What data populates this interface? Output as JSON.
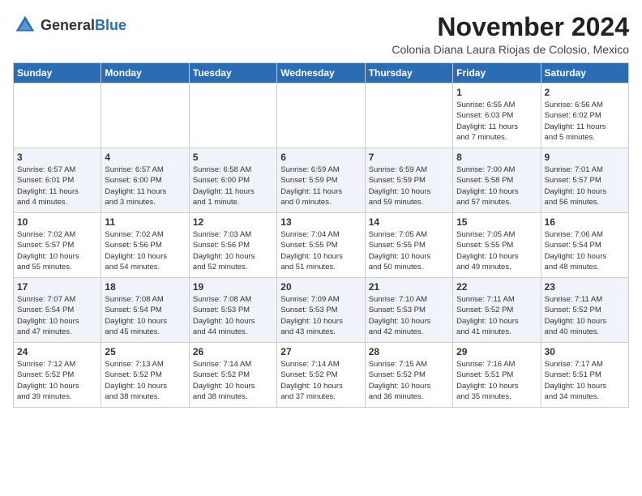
{
  "logo": {
    "general": "General",
    "blue": "Blue"
  },
  "title": "November 2024",
  "subtitle": "Colonia Diana Laura Riojas de Colosio, Mexico",
  "weekdays": [
    "Sunday",
    "Monday",
    "Tuesday",
    "Wednesday",
    "Thursday",
    "Friday",
    "Saturday"
  ],
  "weeks": [
    [
      {
        "day": "",
        "info": ""
      },
      {
        "day": "",
        "info": ""
      },
      {
        "day": "",
        "info": ""
      },
      {
        "day": "",
        "info": ""
      },
      {
        "day": "",
        "info": ""
      },
      {
        "day": "1",
        "info": "Sunrise: 6:55 AM\nSunset: 6:03 PM\nDaylight: 11 hours\nand 7 minutes."
      },
      {
        "day": "2",
        "info": "Sunrise: 6:56 AM\nSunset: 6:02 PM\nDaylight: 11 hours\nand 5 minutes."
      }
    ],
    [
      {
        "day": "3",
        "info": "Sunrise: 6:57 AM\nSunset: 6:01 PM\nDaylight: 11 hours\nand 4 minutes."
      },
      {
        "day": "4",
        "info": "Sunrise: 6:57 AM\nSunset: 6:00 PM\nDaylight: 11 hours\nand 3 minutes."
      },
      {
        "day": "5",
        "info": "Sunrise: 6:58 AM\nSunset: 6:00 PM\nDaylight: 11 hours\nand 1 minute."
      },
      {
        "day": "6",
        "info": "Sunrise: 6:59 AM\nSunset: 5:59 PM\nDaylight: 11 hours\nand 0 minutes."
      },
      {
        "day": "7",
        "info": "Sunrise: 6:59 AM\nSunset: 5:59 PM\nDaylight: 10 hours\nand 59 minutes."
      },
      {
        "day": "8",
        "info": "Sunrise: 7:00 AM\nSunset: 5:58 PM\nDaylight: 10 hours\nand 57 minutes."
      },
      {
        "day": "9",
        "info": "Sunrise: 7:01 AM\nSunset: 5:57 PM\nDaylight: 10 hours\nand 56 minutes."
      }
    ],
    [
      {
        "day": "10",
        "info": "Sunrise: 7:02 AM\nSunset: 5:57 PM\nDaylight: 10 hours\nand 55 minutes."
      },
      {
        "day": "11",
        "info": "Sunrise: 7:02 AM\nSunset: 5:56 PM\nDaylight: 10 hours\nand 54 minutes."
      },
      {
        "day": "12",
        "info": "Sunrise: 7:03 AM\nSunset: 5:56 PM\nDaylight: 10 hours\nand 52 minutes."
      },
      {
        "day": "13",
        "info": "Sunrise: 7:04 AM\nSunset: 5:55 PM\nDaylight: 10 hours\nand 51 minutes."
      },
      {
        "day": "14",
        "info": "Sunrise: 7:05 AM\nSunset: 5:55 PM\nDaylight: 10 hours\nand 50 minutes."
      },
      {
        "day": "15",
        "info": "Sunrise: 7:05 AM\nSunset: 5:55 PM\nDaylight: 10 hours\nand 49 minutes."
      },
      {
        "day": "16",
        "info": "Sunrise: 7:06 AM\nSunset: 5:54 PM\nDaylight: 10 hours\nand 48 minutes."
      }
    ],
    [
      {
        "day": "17",
        "info": "Sunrise: 7:07 AM\nSunset: 5:54 PM\nDaylight: 10 hours\nand 47 minutes."
      },
      {
        "day": "18",
        "info": "Sunrise: 7:08 AM\nSunset: 5:54 PM\nDaylight: 10 hours\nand 45 minutes."
      },
      {
        "day": "19",
        "info": "Sunrise: 7:08 AM\nSunset: 5:53 PM\nDaylight: 10 hours\nand 44 minutes."
      },
      {
        "day": "20",
        "info": "Sunrise: 7:09 AM\nSunset: 5:53 PM\nDaylight: 10 hours\nand 43 minutes."
      },
      {
        "day": "21",
        "info": "Sunrise: 7:10 AM\nSunset: 5:53 PM\nDaylight: 10 hours\nand 42 minutes."
      },
      {
        "day": "22",
        "info": "Sunrise: 7:11 AM\nSunset: 5:52 PM\nDaylight: 10 hours\nand 41 minutes."
      },
      {
        "day": "23",
        "info": "Sunrise: 7:11 AM\nSunset: 5:52 PM\nDaylight: 10 hours\nand 40 minutes."
      }
    ],
    [
      {
        "day": "24",
        "info": "Sunrise: 7:12 AM\nSunset: 5:52 PM\nDaylight: 10 hours\nand 39 minutes."
      },
      {
        "day": "25",
        "info": "Sunrise: 7:13 AM\nSunset: 5:52 PM\nDaylight: 10 hours\nand 38 minutes."
      },
      {
        "day": "26",
        "info": "Sunrise: 7:14 AM\nSunset: 5:52 PM\nDaylight: 10 hours\nand 38 minutes."
      },
      {
        "day": "27",
        "info": "Sunrise: 7:14 AM\nSunset: 5:52 PM\nDaylight: 10 hours\nand 37 minutes."
      },
      {
        "day": "28",
        "info": "Sunrise: 7:15 AM\nSunset: 5:52 PM\nDaylight: 10 hours\nand 36 minutes."
      },
      {
        "day": "29",
        "info": "Sunrise: 7:16 AM\nSunset: 5:51 PM\nDaylight: 10 hours\nand 35 minutes."
      },
      {
        "day": "30",
        "info": "Sunrise: 7:17 AM\nSunset: 5:51 PM\nDaylight: 10 hours\nand 34 minutes."
      }
    ]
  ]
}
